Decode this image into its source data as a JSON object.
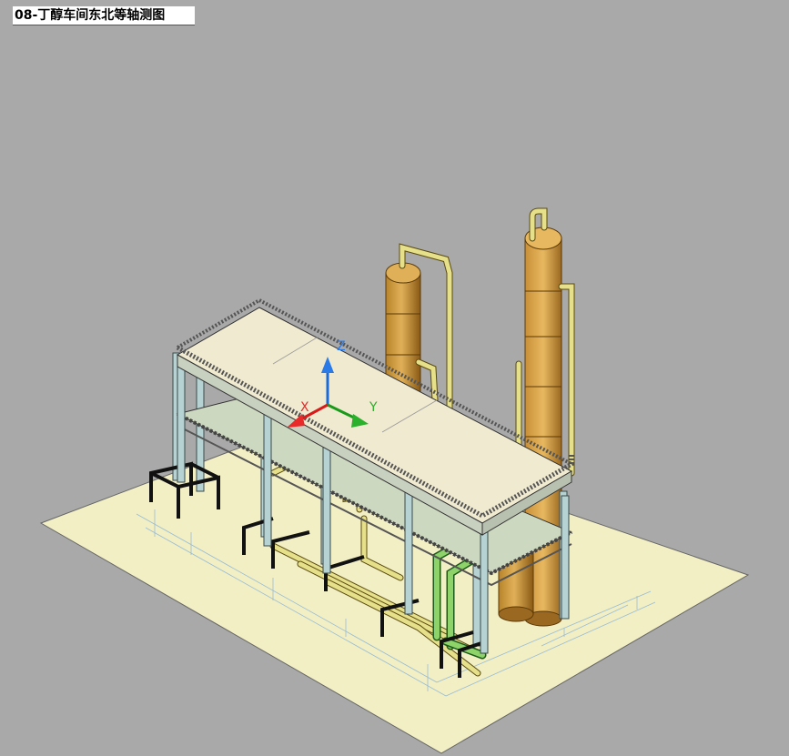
{
  "view": {
    "title": "08-丁醇车间东北等轴测图",
    "background_color": "#a9a9a9",
    "floor_color": "#f2efc5",
    "ucs": {
      "x_label": "X",
      "y_label": "Y",
      "z_label": "Z"
    }
  }
}
